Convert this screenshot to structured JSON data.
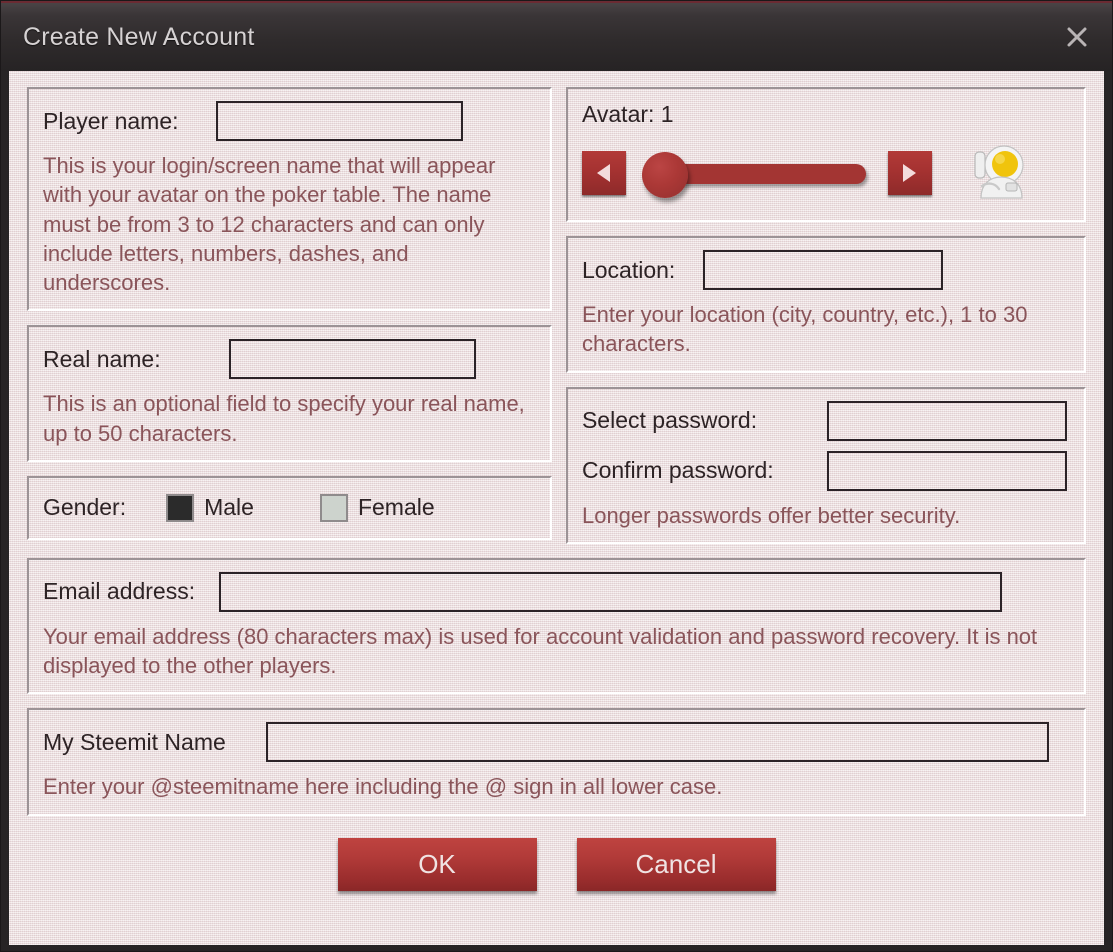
{
  "window": {
    "title": "Create New Account",
    "close_icon": "close-icon"
  },
  "colors": {
    "titlebar_bg": "#2f2b2c",
    "body_bg": "#ece0e0",
    "accent_red": "#a33533",
    "button_red": "#b23b39",
    "help_text": "#8a555a",
    "label_text": "#2d2325"
  },
  "player": {
    "label": "Player name:",
    "value": "",
    "placeholder": "",
    "help": "This is your login/screen name that will appear with your avatar on the poker table. The name must be from 3 to 12 characters and can only include letters, numbers, dashes, and underscores."
  },
  "realname": {
    "label": "Real name:",
    "value": "",
    "placeholder": "",
    "help": "This is an optional field to specify your real name, up to 50 characters."
  },
  "gender": {
    "label": "Gender:",
    "male_label": "Male",
    "female_label": "Female",
    "selected": "Male"
  },
  "avatar": {
    "caption": "Avatar: 1",
    "value": 1,
    "min": 1,
    "slider_position_percent": 0,
    "prev_icon": "triangle-left-icon",
    "next_icon": "triangle-right-icon",
    "preview_icon": "astronaut-avatar-icon"
  },
  "location": {
    "label": "Location:",
    "value": "",
    "placeholder": "",
    "help": "Enter your location (city, country, etc.), 1 to 30 characters."
  },
  "password": {
    "select_label": "Select password:",
    "select_value": "",
    "confirm_label": "Confirm password:",
    "confirm_value": "",
    "help": "Longer passwords offer better security."
  },
  "email": {
    "label": "Email address:",
    "value": "",
    "placeholder": "",
    "help": "Your email address (80 characters max) is used for account validation and password recovery. It is not displayed to the other players."
  },
  "steemit": {
    "label": "My Steemit Name",
    "value": "",
    "placeholder": "",
    "help": "Enter your @steemitname here including the @ sign in all lower case."
  },
  "footer": {
    "ok_label": "OK",
    "cancel_label": "Cancel"
  }
}
